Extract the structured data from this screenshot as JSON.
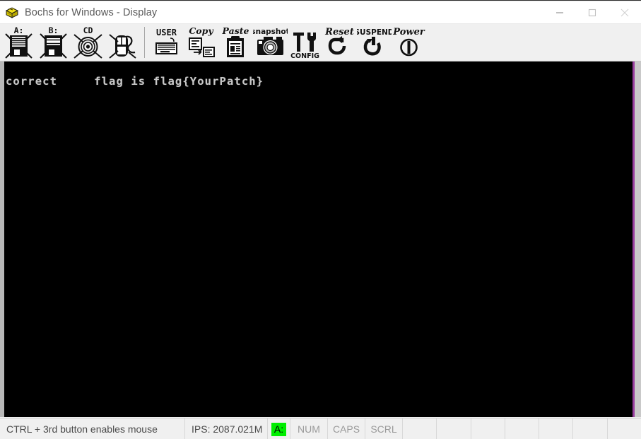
{
  "window": {
    "title": "Bochs for Windows - Display",
    "icon": "bochs-box-icon",
    "controls": [
      {
        "name": "minimize-button",
        "glyph": "minimize-icon"
      },
      {
        "name": "maximize-button",
        "glyph": "maximize-icon"
      },
      {
        "name": "close-button",
        "glyph": "close-icon"
      }
    ]
  },
  "toolbar": {
    "buttons": [
      {
        "id": "floppy-a",
        "label": "A:",
        "icon": "floppy-a-icon",
        "disabled": true
      },
      {
        "id": "floppy-b",
        "label": "B:",
        "icon": "floppy-b-icon",
        "disabled": true
      },
      {
        "id": "cdrom",
        "label": "CD",
        "icon": "cdrom-icon",
        "disabled": true
      },
      {
        "id": "mouse",
        "label": "",
        "icon": "mouse-disabled-icon",
        "disabled": true
      },
      {
        "id": "user",
        "label": "USER",
        "icon": "keyboard-icon",
        "disabled": false
      },
      {
        "id": "copy",
        "label": "Copy",
        "icon": "copy-icon",
        "disabled": false
      },
      {
        "id": "paste",
        "label": "Paste",
        "icon": "paste-icon",
        "disabled": false
      },
      {
        "id": "snapshot",
        "label": "Snapshot",
        "icon": "camera-icon",
        "disabled": false
      },
      {
        "id": "config",
        "label": "CONFIG",
        "icon": "config-tools-icon",
        "disabled": false
      },
      {
        "id": "reset",
        "label": "Reset",
        "icon": "reset-arrow-icon",
        "disabled": false
      },
      {
        "id": "suspend",
        "label": "SUSPEND",
        "icon": "suspend-icon",
        "disabled": false
      },
      {
        "id": "power",
        "label": "Power",
        "icon": "power-icon",
        "disabled": false
      }
    ]
  },
  "display": {
    "background_color": "#000000",
    "text_color": "#c8c8c8",
    "edge_color": "#9a3fa0",
    "lines": [
      "correct     flag is flag{YourPatch}"
    ]
  },
  "statusbar": {
    "mouse_message": "CTRL + 3rd button enables mouse",
    "ips": "IPS: 2087.021M",
    "floppy_led": {
      "label": "A:",
      "color": "#00ee00",
      "active": true
    },
    "indicators": [
      {
        "label": "NUM",
        "active": false
      },
      {
        "label": "CAPS",
        "active": false
      },
      {
        "label": "SCRL",
        "active": false
      }
    ],
    "empty_cells": 7
  }
}
